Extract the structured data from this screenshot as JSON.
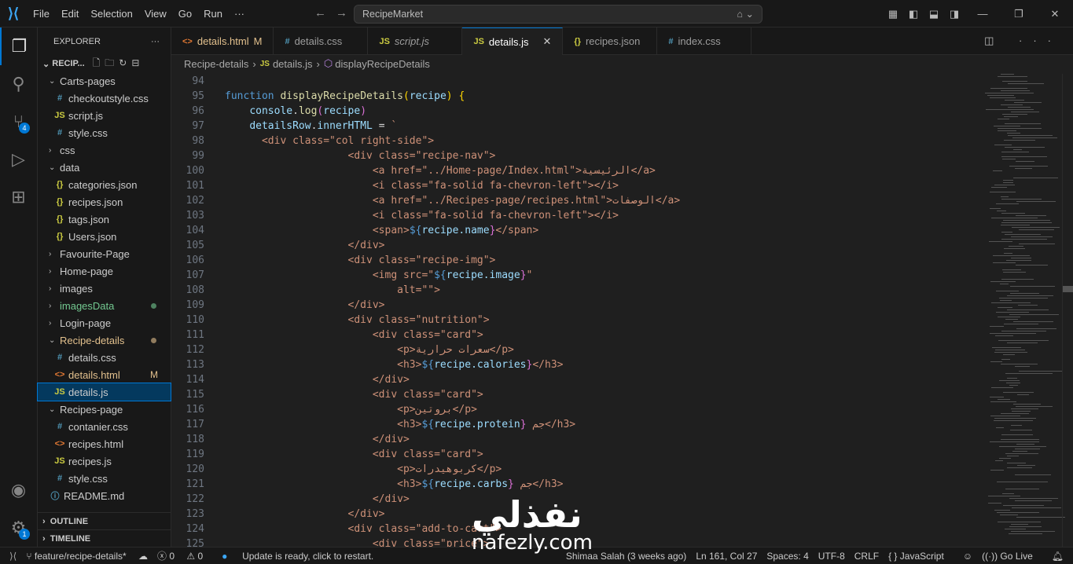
{
  "titlebar": {
    "menu": [
      "File",
      "Edit",
      "Selection",
      "View",
      "Go",
      "Run",
      "···"
    ],
    "search": "RecipeMarket"
  },
  "activity": {
    "scm_badge": "4",
    "settings_badge": "1"
  },
  "explorer": {
    "title": "EXPLORER",
    "more": "···",
    "root": "RECIP...",
    "items": [
      {
        "label": "Carts-pages",
        "type": "folder",
        "depth": 1,
        "open": true
      },
      {
        "label": "checkoutstyle.css",
        "type": "css",
        "depth": 2
      },
      {
        "label": "script.js",
        "type": "js",
        "depth": 2
      },
      {
        "label": "style.css",
        "type": "css",
        "depth": 2
      },
      {
        "label": "css",
        "type": "folder",
        "depth": 1
      },
      {
        "label": "data",
        "type": "folder",
        "depth": 1,
        "open": true
      },
      {
        "label": "categories.json",
        "type": "json",
        "depth": 2
      },
      {
        "label": "recipes.json",
        "type": "json",
        "depth": 2
      },
      {
        "label": "tags.json",
        "type": "json",
        "depth": 2
      },
      {
        "label": "Users.json",
        "type": "json",
        "depth": 2
      },
      {
        "label": "Favourite-Page",
        "type": "folder",
        "depth": 1
      },
      {
        "label": "Home-page",
        "type": "folder",
        "depth": 1
      },
      {
        "label": "images",
        "type": "folder",
        "depth": 1
      },
      {
        "label": "imagesData",
        "type": "folder",
        "depth": 1,
        "color": "#73c991",
        "dot": "#73c991"
      },
      {
        "label": "Login-page",
        "type": "folder",
        "depth": 1
      },
      {
        "label": "Recipe-details",
        "type": "folder",
        "depth": 1,
        "open": true,
        "color": "#e2c08d",
        "dot": "#e2c08d"
      },
      {
        "label": "details.css",
        "type": "css",
        "depth": 2
      },
      {
        "label": "details.html",
        "type": "html",
        "depth": 2,
        "color": "#e2c08d",
        "tag": "M"
      },
      {
        "label": "details.js",
        "type": "js",
        "depth": 2,
        "selected": true
      },
      {
        "label": "Recipes-page",
        "type": "folder",
        "depth": 1,
        "open": true
      },
      {
        "label": "contanier.css",
        "type": "css",
        "depth": 2
      },
      {
        "label": "recipes.html",
        "type": "html",
        "depth": 2
      },
      {
        "label": "recipes.js",
        "type": "js",
        "depth": 2
      },
      {
        "label": "style.css",
        "type": "css",
        "depth": 2
      },
      {
        "label": "README.md",
        "type": "md",
        "depth": 1
      }
    ],
    "outline": "OUTLINE",
    "timeline": "TIMELINE"
  },
  "tabs": [
    {
      "label": "details.html",
      "type": "html",
      "modified": "M"
    },
    {
      "label": "details.css",
      "type": "css"
    },
    {
      "label": "script.js",
      "type": "js",
      "italic": true
    },
    {
      "label": "details.js",
      "type": "js",
      "active": true,
      "close": "✕"
    },
    {
      "label": "recipes.json",
      "type": "json"
    },
    {
      "label": "index.css",
      "type": "css"
    }
  ],
  "breadcrumb": {
    "folder": "Recipe-details",
    "file": "details.js",
    "symbol": "displayRecipeDetails"
  },
  "code": [
    {
      "n": "94",
      "s": []
    },
    {
      "n": "95",
      "s": [
        [
          "k",
          "function "
        ],
        [
          "f",
          "displayRecipeDetails"
        ],
        [
          "b1",
          "("
        ],
        [
          "p",
          "recipe"
        ],
        [
          "b1",
          ")"
        ],
        [
          "t",
          " "
        ],
        [
          "b1",
          "{"
        ]
      ]
    },
    {
      "n": "96",
      "s": [
        [
          "t",
          "    "
        ],
        [
          "p",
          "console"
        ],
        [
          "t",
          "."
        ],
        [
          "f",
          "log"
        ],
        [
          "b2",
          "("
        ],
        [
          "p",
          "recipe"
        ],
        [
          "b2",
          ")"
        ]
      ]
    },
    {
      "n": "97",
      "s": [
        [
          "t",
          "    "
        ],
        [
          "p",
          "detailsRow"
        ],
        [
          "t",
          "."
        ],
        [
          "p",
          "innerHTML"
        ],
        [
          "t",
          " = "
        ],
        [
          "st",
          "`"
        ]
      ]
    },
    {
      "n": "98",
      "s": [
        [
          "st",
          "      <div class=\"col right-side\">"
        ]
      ]
    },
    {
      "n": "99",
      "s": [
        [
          "st",
          "                    <div class=\"recipe-nav\">"
        ]
      ]
    },
    {
      "n": "100",
      "s": [
        [
          "st",
          "                        <a href=\"../Home-page/Index.html\">"
        ],
        [
          "ar",
          "الرئيسية"
        ],
        [
          "st",
          "</a>"
        ]
      ]
    },
    {
      "n": "101",
      "s": [
        [
          "st",
          "                        <i class=\"fa-solid fa-chevron-left\"></i>"
        ]
      ]
    },
    {
      "n": "102",
      "s": [
        [
          "st",
          "                        <a href=\"../Recipes-page/recipes.html\">"
        ],
        [
          "ar",
          "الوصفات"
        ],
        [
          "st",
          "</a>"
        ]
      ]
    },
    {
      "n": "103",
      "s": [
        [
          "st",
          "                        <i class=\"fa-solid fa-chevron-left\"></i>"
        ]
      ]
    },
    {
      "n": "104",
      "s": [
        [
          "st",
          "                        <span>"
        ],
        [
          "tp",
          "${"
        ],
        [
          "p",
          "recipe.name"
        ],
        [
          "b2",
          "}"
        ],
        [
          "st",
          "</span>"
        ]
      ]
    },
    {
      "n": "105",
      "s": [
        [
          "st",
          "                    </div>"
        ]
      ]
    },
    {
      "n": "106",
      "s": [
        [
          "st",
          "                    <div class=\"recipe-img\">"
        ]
      ]
    },
    {
      "n": "107",
      "s": [
        [
          "st",
          "                        <img src=\""
        ],
        [
          "tp",
          "${"
        ],
        [
          "p",
          "recipe.image"
        ],
        [
          "b2",
          "}"
        ],
        [
          "st",
          "\""
        ]
      ]
    },
    {
      "n": "108",
      "s": [
        [
          "st",
          "                            alt=\"\">"
        ]
      ]
    },
    {
      "n": "109",
      "s": [
        [
          "st",
          "                    </div>"
        ]
      ]
    },
    {
      "n": "110",
      "s": [
        [
          "st",
          "                    <div class=\"nutrition\">"
        ]
      ]
    },
    {
      "n": "111",
      "s": [
        [
          "st",
          "                        <div class=\"card\">"
        ]
      ]
    },
    {
      "n": "112",
      "s": [
        [
          "st",
          "                            <p>"
        ],
        [
          "ar",
          "سعرات حرارية"
        ],
        [
          "st",
          "</p>"
        ]
      ]
    },
    {
      "n": "113",
      "s": [
        [
          "st",
          "                            <h3>"
        ],
        [
          "tp",
          "${"
        ],
        [
          "p",
          "recipe.calories"
        ],
        [
          "b2",
          "}"
        ],
        [
          "st",
          "</h3>"
        ]
      ]
    },
    {
      "n": "114",
      "s": [
        [
          "st",
          "                        </div>"
        ]
      ]
    },
    {
      "n": "115",
      "s": [
        [
          "st",
          "                        <div class=\"card\">"
        ]
      ]
    },
    {
      "n": "116",
      "s": [
        [
          "st",
          "                            <p>"
        ],
        [
          "ar",
          "بروتين"
        ],
        [
          "st",
          "</p>"
        ]
      ]
    },
    {
      "n": "117",
      "s": [
        [
          "st",
          "                            <h3>"
        ],
        [
          "tp",
          "${"
        ],
        [
          "p",
          "recipe.protein"
        ],
        [
          "b2",
          "}"
        ],
        [
          "st",
          " "
        ],
        [
          "ar",
          "جم"
        ],
        [
          "st",
          "</h3>"
        ]
      ]
    },
    {
      "n": "118",
      "s": [
        [
          "st",
          "                        </div>"
        ]
      ]
    },
    {
      "n": "119",
      "s": [
        [
          "st",
          "                        <div class=\"card\">"
        ]
      ]
    },
    {
      "n": "120",
      "s": [
        [
          "st",
          "                            <p>"
        ],
        [
          "ar",
          "كربوهيدرات"
        ],
        [
          "st",
          "</p>"
        ]
      ]
    },
    {
      "n": "121",
      "s": [
        [
          "st",
          "                            <h3>"
        ],
        [
          "tp",
          "${"
        ],
        [
          "p",
          "recipe.carbs"
        ],
        [
          "b2",
          "}"
        ],
        [
          "st",
          " "
        ],
        [
          "ar",
          "جم"
        ],
        [
          "st",
          "</h3>"
        ]
      ]
    },
    {
      "n": "122",
      "s": [
        [
          "st",
          "                        </div>"
        ]
      ]
    },
    {
      "n": "123",
      "s": [
        [
          "st",
          "                    </div>"
        ]
      ]
    },
    {
      "n": "124",
      "s": [
        [
          "st",
          "                    <div class=\"add-to-cart\">"
        ]
      ]
    },
    {
      "n": "125",
      "s": [
        [
          "st",
          "                        <div class=\"price\">"
        ]
      ]
    }
  ],
  "status": {
    "branch": "feature/recipe-details*",
    "errors": "0",
    "warnings": "0",
    "update": "Update is ready, click to restart.",
    "blame": "Shimaa Salah (3 weeks ago)",
    "position": "Ln 161, Col 27",
    "spaces": "Spaces: 4",
    "encoding": "UTF-8",
    "eol": "CRLF",
    "language": "JavaScript",
    "golive": "Go Live"
  },
  "watermark": {
    "arabic": "نفذلي",
    "latin": "nafezly.com"
  },
  "colors": {
    "accent": "#0078d4",
    "string": "#ce9178",
    "keyword": "#569cd6"
  }
}
